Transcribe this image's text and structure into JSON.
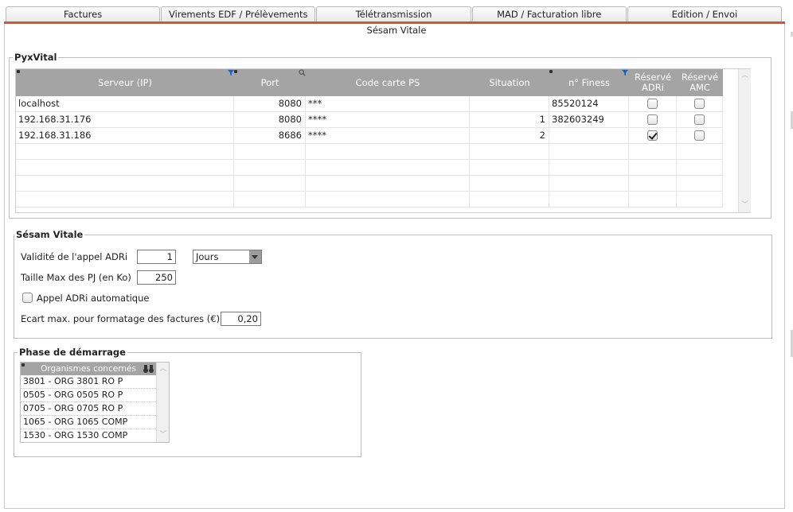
{
  "tabs": [
    "Factures",
    "Virements EDF / Prélèvements",
    "Télétransmission",
    "MAD / Facturation libre",
    "Edition / Envoi"
  ],
  "subtab": "Sésam Vitale",
  "pyxvital": {
    "legend": "PyxVital",
    "columns": [
      "Serveur (IP)",
      "Port",
      "Code carte PS",
      "Situation",
      "n° Finess",
      "Réservé ADRi",
      "Réservé AMC"
    ],
    "rows": [
      {
        "server": "localhost",
        "port": "8080",
        "code": "***",
        "situation": "",
        "finess": "85520124",
        "adri": false,
        "amc": false
      },
      {
        "server": "192.168.31.176",
        "port": "8080",
        "code": "****",
        "situation": "1",
        "finess": "382603249",
        "adri": false,
        "amc": false
      },
      {
        "server": "192.168.31.186",
        "port": "8686",
        "code": "****",
        "situation": "2",
        "finess": "",
        "adri": true,
        "amc": false
      }
    ]
  },
  "sesam": {
    "legend": "Sésam Vitale",
    "validite_label": "Validité de l'appel ADRi",
    "validite_value": "1",
    "validite_unit": "Jours",
    "taille_label": "Taille Max des PJ (en Ko)",
    "taille_value": "250",
    "auto_label": "Appel ADRi automatique",
    "auto_checked": false,
    "ecart_label": "Ecart max. pour formatage des factures (€)",
    "ecart_value": "0,20"
  },
  "demarrage": {
    "legend": "Phase de démarrage",
    "header": "Organismes concernés",
    "items": [
      "3801 - ORG 3801 RO P",
      "0505 - ORG 0505 RO P",
      "0705 - ORG 0705 RO P",
      "1065 - ORG 1065 COMP",
      "1530 - ORG 1530 COMP"
    ]
  }
}
